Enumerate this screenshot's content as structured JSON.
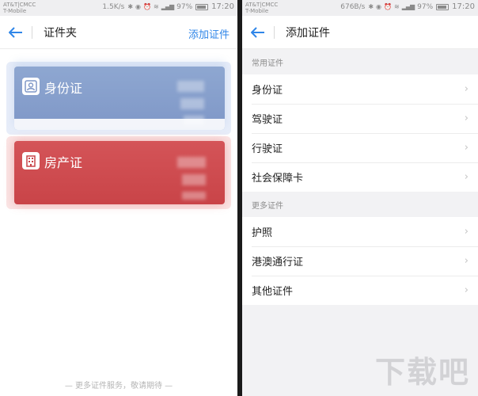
{
  "left": {
    "status": {
      "carrier1": "AT&T|CMCC",
      "carrier2": "T-Mobile",
      "speed": "1.5K/s",
      "battery": "97%",
      "time": "17:20"
    },
    "nav": {
      "title": "证件夹",
      "action": "添加证件",
      "back_icon": "back-arrow-icon"
    },
    "cards": [
      {
        "label": "身份证",
        "icon": "id-card-icon",
        "color": "#8ea7d1"
      },
      {
        "label": "房产证",
        "icon": "building-icon",
        "color": "#d45458"
      }
    ],
    "footer": "— 更多证件服务，敬请期待 —"
  },
  "right": {
    "status": {
      "carrier1": "AT&T|CMCC",
      "carrier2": "T-Mobile",
      "speed": "676B/s",
      "battery": "97%",
      "time": "17:20"
    },
    "nav": {
      "title": "添加证件",
      "back_icon": "back-arrow-icon"
    },
    "sections": [
      {
        "header": "常用证件",
        "items": [
          "身份证",
          "驾驶证",
          "行驶证",
          "社会保障卡"
        ]
      },
      {
        "header": "更多证件",
        "items": [
          "护照",
          "港澳通行证",
          "其他证件"
        ]
      }
    ],
    "watermark": "下载吧"
  },
  "colors": {
    "accent": "#2f86e8",
    "id_card": "#8ea7d1",
    "house_card": "#d45458"
  }
}
